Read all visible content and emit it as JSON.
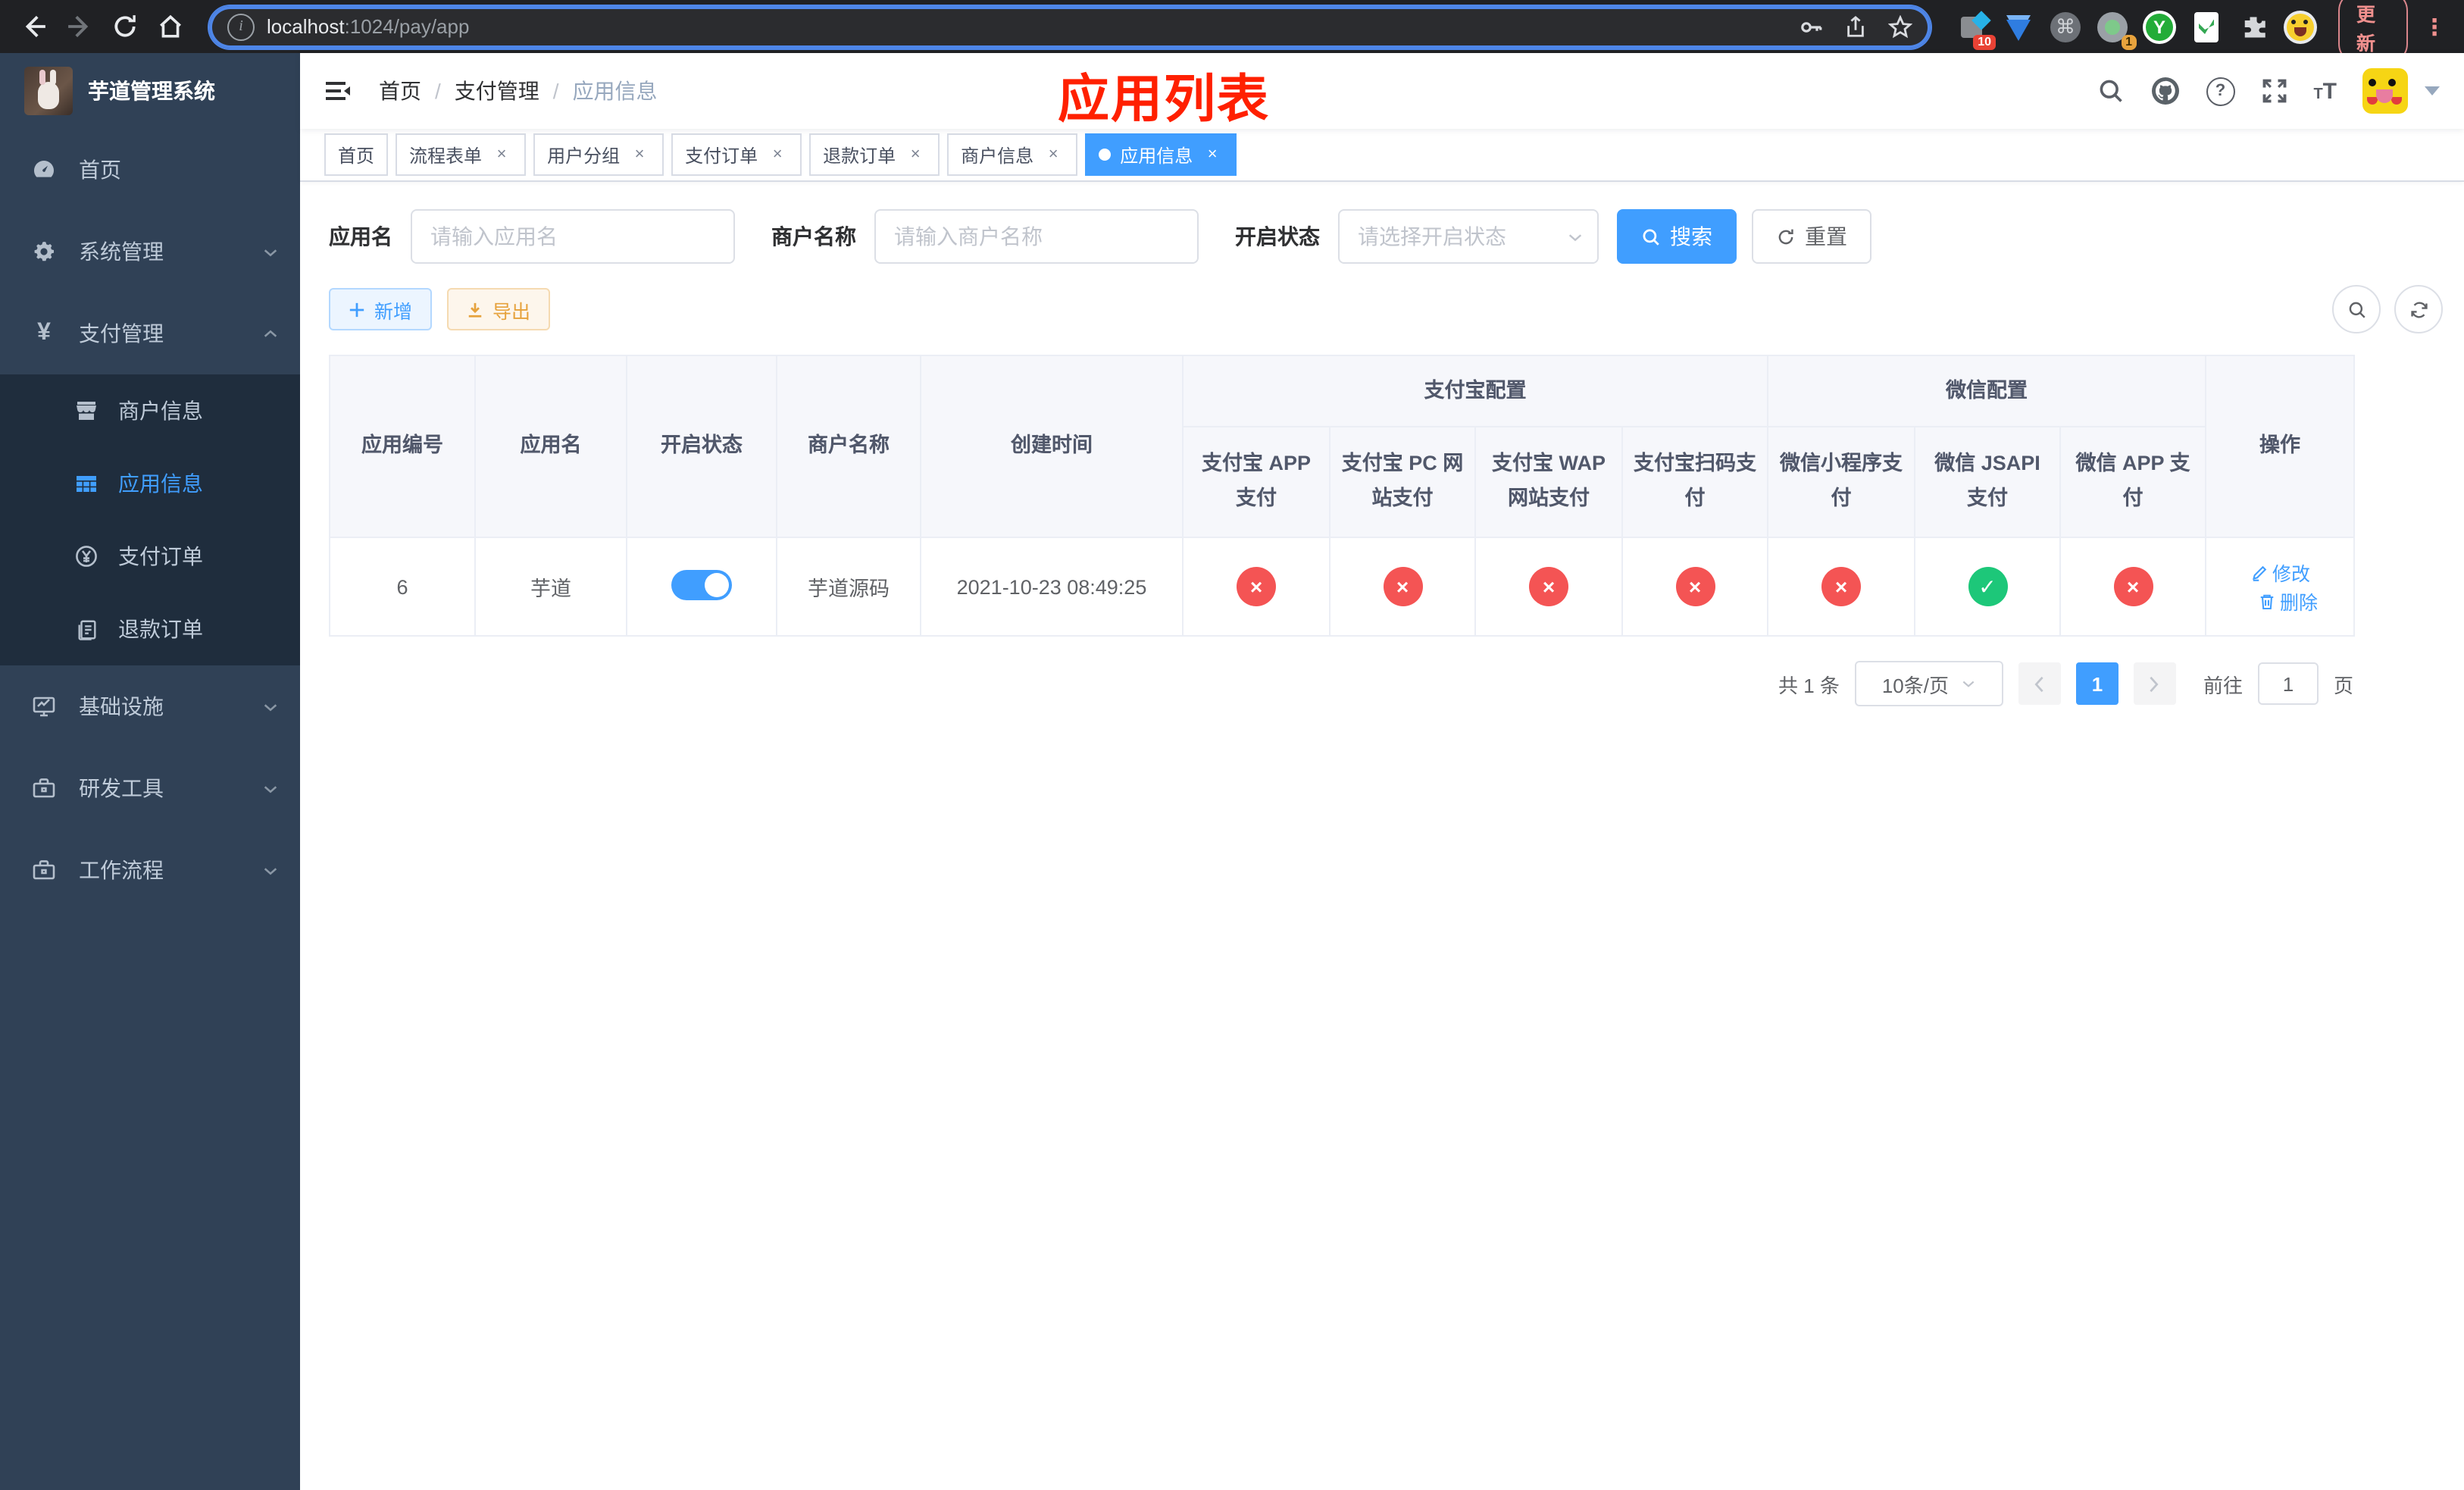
{
  "colors": {
    "primary": "#409eff",
    "danger": "#f45454",
    "success": "#1dc779",
    "annotation_red": "#ff2000",
    "sidebar_bg": "#304156",
    "submenu_bg": "#1f2d3d"
  },
  "browser": {
    "url_host": "localhost",
    "url_path": ":1024/pay/app",
    "ext_badge_pieces": "10",
    "ext_badge_cam": "1",
    "ext_y_letter": "Y",
    "update_label": "更新"
  },
  "sidebar": {
    "title": "芋道管理系统",
    "home": "首页",
    "system": "系统管理",
    "payment": "支付管理",
    "merchant_info": "商户信息",
    "app_info": "应用信息",
    "pay_order": "支付订单",
    "refund_order": "退款订单",
    "infra": "基础设施",
    "dev_tools": "研发工具",
    "workflow": "工作流程"
  },
  "header": {
    "breadcrumb_home": "首页",
    "breadcrumb_section": "支付管理",
    "breadcrumb_current": "应用信息",
    "annotation": "应用列表"
  },
  "tabs": {
    "home": "首页",
    "t1": "流程表单",
    "t2": "用户分组",
    "t3": "支付订单",
    "t4": "退款订单",
    "t5": "商户信息",
    "active": "应用信息"
  },
  "filters": {
    "app_name_label": "应用名",
    "app_name_placeholder": "请输入应用名",
    "merchant_label": "商户名称",
    "merchant_placeholder": "请输入商户名称",
    "status_label": "开启状态",
    "status_placeholder": "请选择开启状态",
    "search_label": "搜索",
    "reset_label": "重置"
  },
  "toolbar": {
    "add_label": "新增",
    "export_label": "导出"
  },
  "table": {
    "col_id": "应用编号",
    "col_name": "应用名",
    "col_status": "开启状态",
    "col_merchant": "商户名称",
    "col_created": "创建时间",
    "group_alipay": "支付宝配置",
    "group_wechat": "微信配置",
    "col_alipay_app": "支付宝 APP 支付",
    "col_alipay_pc": "支付宝 PC 网站支付",
    "col_alipay_wap": "支付宝 WAP 网站支付",
    "col_alipay_qr": "支付宝扫码支付",
    "col_wx_mini": "微信小程序支付",
    "col_wx_jsapi": "微信 JSAPI 支付",
    "col_wx_app": "微信 APP 支付",
    "col_actions": "操作",
    "row": {
      "id": "6",
      "name": "芋道",
      "enabled": true,
      "merchant": "芋道源码",
      "created": "2021-10-23 08:49:25",
      "alipay_app": "disabled",
      "alipay_pc": "disabled",
      "alipay_wap": "disabled",
      "alipay_qr": "disabled",
      "wx_mini": "disabled",
      "wx_jsapi": "enabled",
      "wx_app": "disabled"
    },
    "edit_label": "修改",
    "delete_label": "删除"
  },
  "pagination": {
    "total_label": "共 1 条",
    "page_size_label": "10条/页",
    "current_page": "1",
    "goto_label": "前往",
    "goto_value": "1",
    "page_unit": "页"
  }
}
